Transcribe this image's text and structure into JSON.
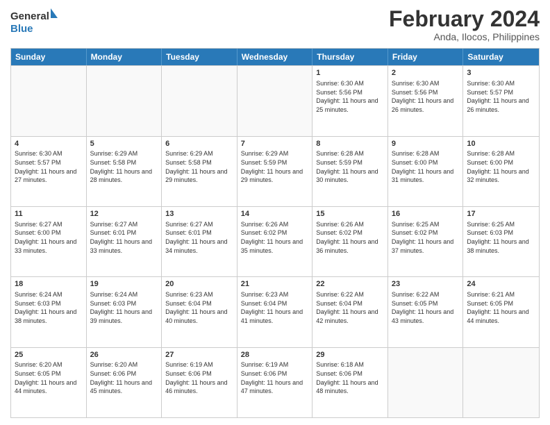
{
  "logo": {
    "line1": "General",
    "line2": "Blue"
  },
  "title": {
    "month_year": "February 2024",
    "location": "Anda, Ilocos, Philippines"
  },
  "days_of_week": [
    "Sunday",
    "Monday",
    "Tuesday",
    "Wednesday",
    "Thursday",
    "Friday",
    "Saturday"
  ],
  "weeks": [
    [
      {
        "day": "",
        "info": ""
      },
      {
        "day": "",
        "info": ""
      },
      {
        "day": "",
        "info": ""
      },
      {
        "day": "",
        "info": ""
      },
      {
        "day": "1",
        "info": "Sunrise: 6:30 AM\nSunset: 5:56 PM\nDaylight: 11 hours and 25 minutes."
      },
      {
        "day": "2",
        "info": "Sunrise: 6:30 AM\nSunset: 5:56 PM\nDaylight: 11 hours and 26 minutes."
      },
      {
        "day": "3",
        "info": "Sunrise: 6:30 AM\nSunset: 5:57 PM\nDaylight: 11 hours and 26 minutes."
      }
    ],
    [
      {
        "day": "4",
        "info": "Sunrise: 6:30 AM\nSunset: 5:57 PM\nDaylight: 11 hours and 27 minutes."
      },
      {
        "day": "5",
        "info": "Sunrise: 6:29 AM\nSunset: 5:58 PM\nDaylight: 11 hours and 28 minutes."
      },
      {
        "day": "6",
        "info": "Sunrise: 6:29 AM\nSunset: 5:58 PM\nDaylight: 11 hours and 29 minutes."
      },
      {
        "day": "7",
        "info": "Sunrise: 6:29 AM\nSunset: 5:59 PM\nDaylight: 11 hours and 29 minutes."
      },
      {
        "day": "8",
        "info": "Sunrise: 6:28 AM\nSunset: 5:59 PM\nDaylight: 11 hours and 30 minutes."
      },
      {
        "day": "9",
        "info": "Sunrise: 6:28 AM\nSunset: 6:00 PM\nDaylight: 11 hours and 31 minutes."
      },
      {
        "day": "10",
        "info": "Sunrise: 6:28 AM\nSunset: 6:00 PM\nDaylight: 11 hours and 32 minutes."
      }
    ],
    [
      {
        "day": "11",
        "info": "Sunrise: 6:27 AM\nSunset: 6:00 PM\nDaylight: 11 hours and 33 minutes."
      },
      {
        "day": "12",
        "info": "Sunrise: 6:27 AM\nSunset: 6:01 PM\nDaylight: 11 hours and 33 minutes."
      },
      {
        "day": "13",
        "info": "Sunrise: 6:27 AM\nSunset: 6:01 PM\nDaylight: 11 hours and 34 minutes."
      },
      {
        "day": "14",
        "info": "Sunrise: 6:26 AM\nSunset: 6:02 PM\nDaylight: 11 hours and 35 minutes."
      },
      {
        "day": "15",
        "info": "Sunrise: 6:26 AM\nSunset: 6:02 PM\nDaylight: 11 hours and 36 minutes."
      },
      {
        "day": "16",
        "info": "Sunrise: 6:25 AM\nSunset: 6:02 PM\nDaylight: 11 hours and 37 minutes."
      },
      {
        "day": "17",
        "info": "Sunrise: 6:25 AM\nSunset: 6:03 PM\nDaylight: 11 hours and 38 minutes."
      }
    ],
    [
      {
        "day": "18",
        "info": "Sunrise: 6:24 AM\nSunset: 6:03 PM\nDaylight: 11 hours and 38 minutes."
      },
      {
        "day": "19",
        "info": "Sunrise: 6:24 AM\nSunset: 6:03 PM\nDaylight: 11 hours and 39 minutes."
      },
      {
        "day": "20",
        "info": "Sunrise: 6:23 AM\nSunset: 6:04 PM\nDaylight: 11 hours and 40 minutes."
      },
      {
        "day": "21",
        "info": "Sunrise: 6:23 AM\nSunset: 6:04 PM\nDaylight: 11 hours and 41 minutes."
      },
      {
        "day": "22",
        "info": "Sunrise: 6:22 AM\nSunset: 6:04 PM\nDaylight: 11 hours and 42 minutes."
      },
      {
        "day": "23",
        "info": "Sunrise: 6:22 AM\nSunset: 6:05 PM\nDaylight: 11 hours and 43 minutes."
      },
      {
        "day": "24",
        "info": "Sunrise: 6:21 AM\nSunset: 6:05 PM\nDaylight: 11 hours and 44 minutes."
      }
    ],
    [
      {
        "day": "25",
        "info": "Sunrise: 6:20 AM\nSunset: 6:05 PM\nDaylight: 11 hours and 44 minutes."
      },
      {
        "day": "26",
        "info": "Sunrise: 6:20 AM\nSunset: 6:06 PM\nDaylight: 11 hours and 45 minutes."
      },
      {
        "day": "27",
        "info": "Sunrise: 6:19 AM\nSunset: 6:06 PM\nDaylight: 11 hours and 46 minutes."
      },
      {
        "day": "28",
        "info": "Sunrise: 6:19 AM\nSunset: 6:06 PM\nDaylight: 11 hours and 47 minutes."
      },
      {
        "day": "29",
        "info": "Sunrise: 6:18 AM\nSunset: 6:06 PM\nDaylight: 11 hours and 48 minutes."
      },
      {
        "day": "",
        "info": ""
      },
      {
        "day": "",
        "info": ""
      }
    ]
  ]
}
